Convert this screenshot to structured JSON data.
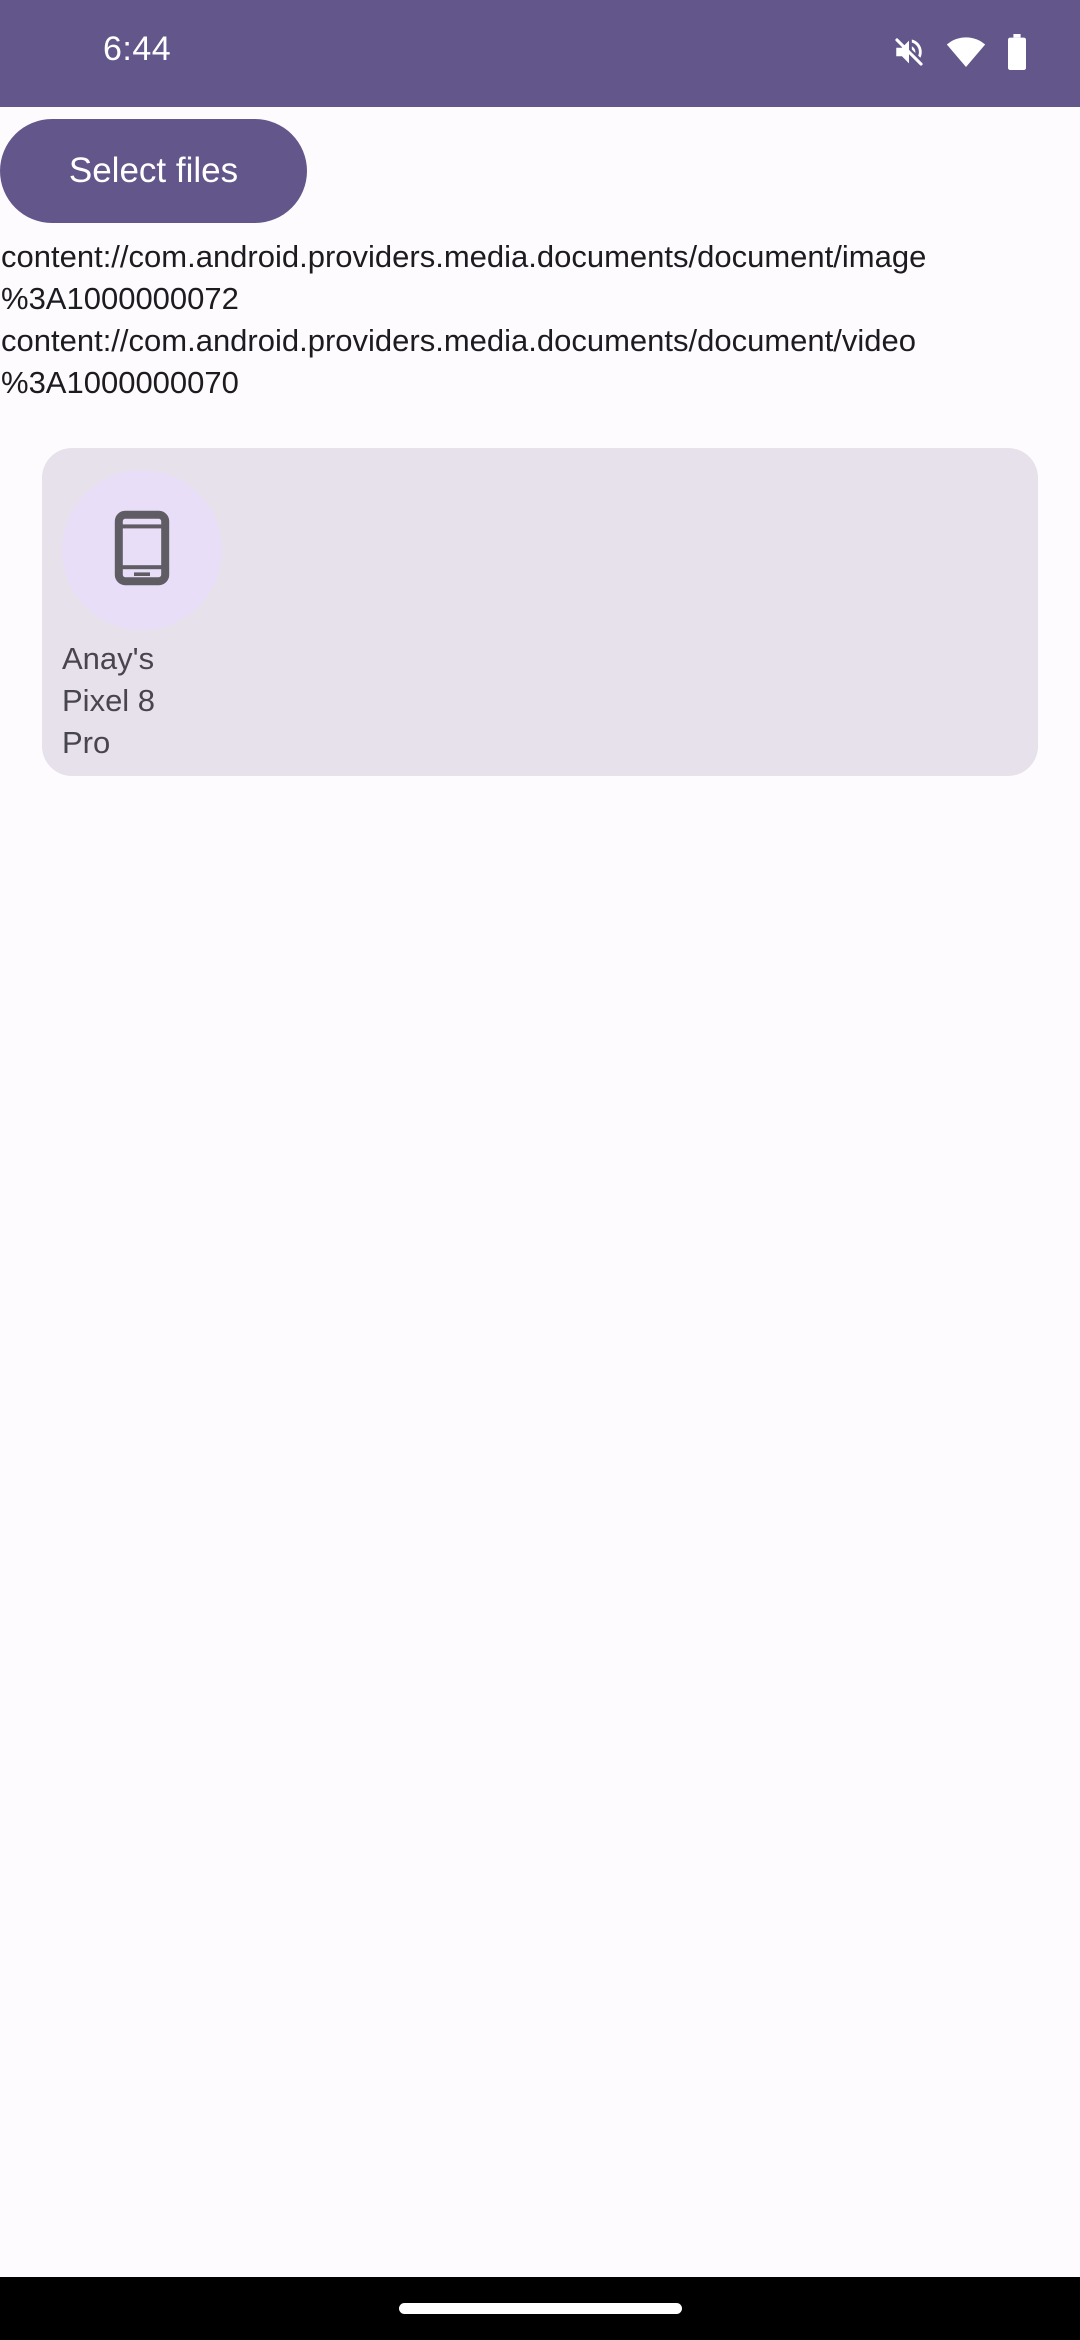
{
  "status_bar": {
    "time": "6:44",
    "icons": [
      "mute-icon",
      "wifi-icon",
      "battery-icon"
    ]
  },
  "actions": {
    "select_files_label": "Select files"
  },
  "selected_uris": [
    {
      "line1": "content://com.android.providers.media.documents/document/image",
      "line2": "%3A1000000072"
    },
    {
      "line1": "content://com.android.providers.media.documents/document/video",
      "line2": "%3A1000000070"
    }
  ],
  "devices": [
    {
      "icon": "smartphone-icon",
      "name_lines": [
        "Anay's",
        "Pixel 8",
        "Pro"
      ]
    }
  ],
  "colors": {
    "primary": "#63568b",
    "background": "#fdfbfe",
    "card": "#e6e1ea",
    "avatar": "#e8def8"
  }
}
